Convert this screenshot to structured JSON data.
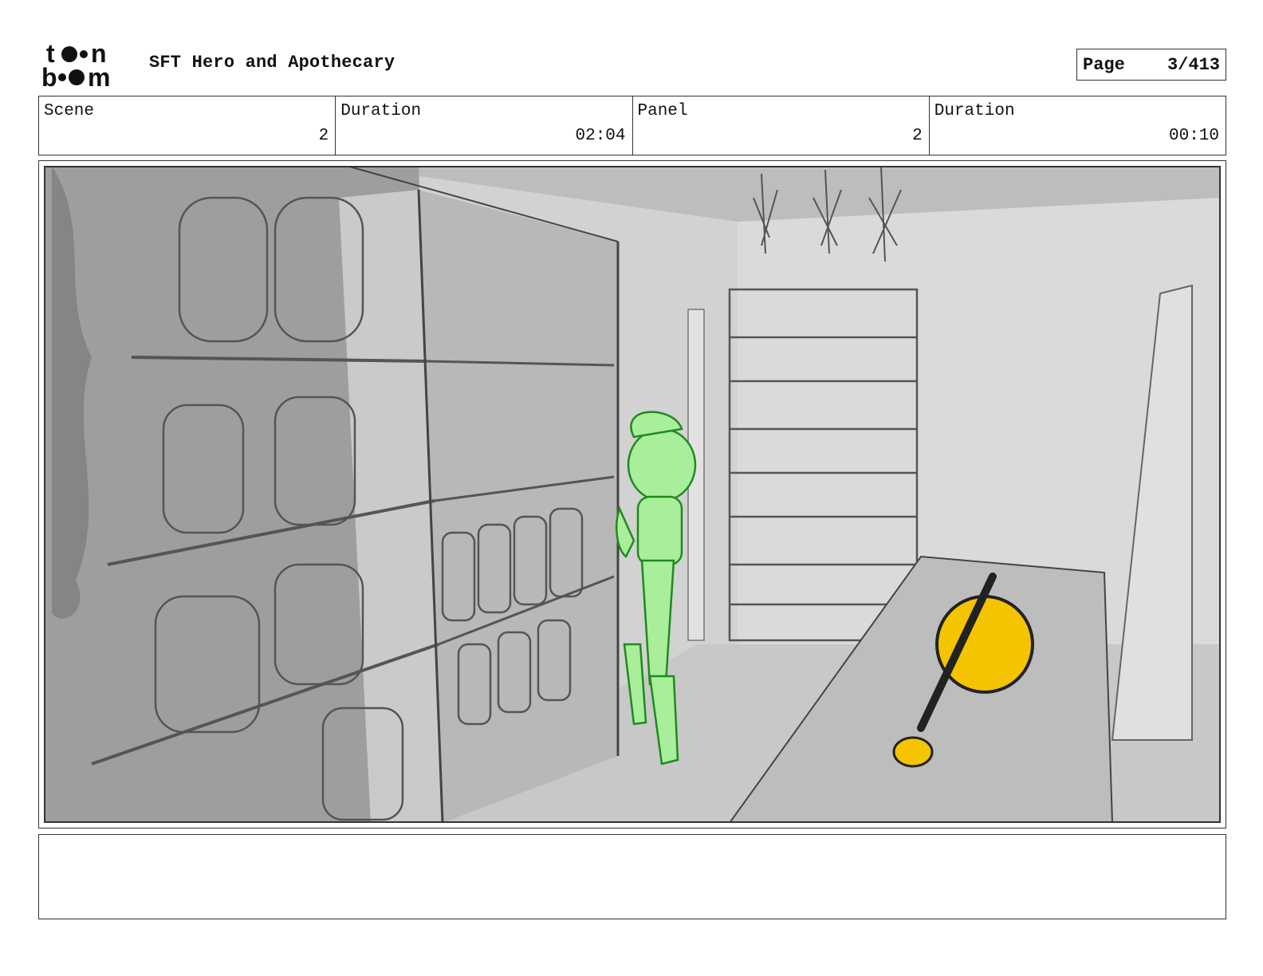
{
  "header": {
    "logo_top": "toon",
    "logo_bottom": "boom",
    "title": "SFT Hero and Apothecary",
    "page_label": "Page",
    "page_value": "3/413"
  },
  "info": {
    "scene_label": "Scene",
    "scene_value": "2",
    "scene_duration_label": "Duration",
    "scene_duration_value": "02:04",
    "panel_label": "Panel",
    "panel_value": "2",
    "panel_duration_label": "Duration",
    "panel_duration_value": "00:10"
  },
  "panel_image": {
    "colors": {
      "background": "#cfcfcf",
      "character": "#a9ee9a",
      "character_line": "#1f8a1f",
      "potion": "#f5c400",
      "line": "#3a3a3a"
    }
  },
  "notes": {
    "text": ""
  }
}
